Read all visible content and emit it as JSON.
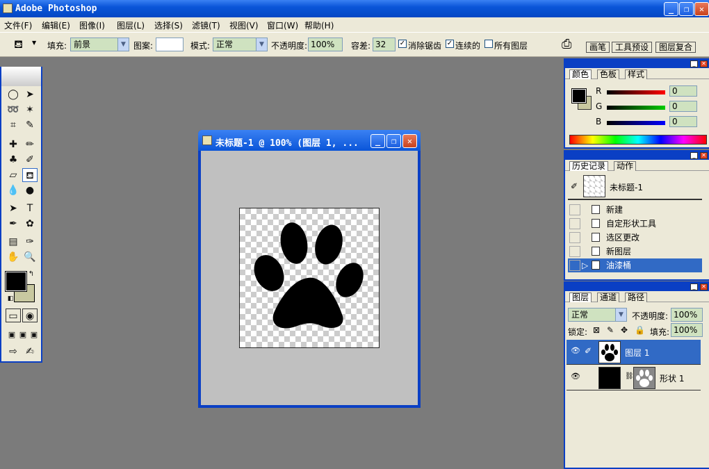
{
  "app": {
    "title": "Adobe Photoshop",
    "window_buttons": {
      "minimize": "_",
      "restore": "❐",
      "close": "✕"
    }
  },
  "menu": [
    "文件(F)",
    "编辑(E)",
    "图像(I)",
    "图层(L)",
    "选择(S)",
    "滤镜(T)",
    "视图(V)",
    "窗口(W)",
    "帮助(H)"
  ],
  "options": {
    "fill_label": "填充:",
    "fill_value": "前景",
    "pattern_label": "图案:",
    "mode_label": "模式:",
    "mode_value": "正常",
    "opacity_label": "不透明度:",
    "opacity_value": "100%",
    "tolerance_label": "容差:",
    "tolerance_value": "32",
    "antialias_label": "消除锯齿",
    "antialias_checked": true,
    "contiguous_label": "连续的",
    "contiguous_checked": true,
    "all_layers_label": "所有图层",
    "all_layers_checked": false,
    "well_tabs": [
      "画笔",
      "工具预设",
      "图层复合"
    ]
  },
  "document": {
    "title": "未标题-1 @ 100% (图层 1, ..."
  },
  "color_panel": {
    "tabs": [
      "颜色",
      "色板",
      "样式"
    ],
    "channels": [
      {
        "name": "R",
        "value": "0"
      },
      {
        "name": "G",
        "value": "0"
      },
      {
        "name": "B",
        "value": "0"
      }
    ],
    "foreground": "#000000",
    "background": "#c8c8a0"
  },
  "history_panel": {
    "tabs": [
      "历史记录",
      "动作"
    ],
    "snapshot": "未标题-1",
    "items": [
      "新建",
      "自定形状工具",
      "选区更改",
      "新图层",
      "油漆桶"
    ],
    "active_index": 4
  },
  "layers_panel": {
    "tabs": [
      "图层",
      "通道",
      "路径"
    ],
    "blend_mode": "正常",
    "opacity_label": "不透明度:",
    "opacity_value": "100%",
    "lock_label": "锁定:",
    "fill_label": "填充:",
    "fill_value": "100%",
    "layers": [
      {
        "name": "图层 1",
        "active": true
      },
      {
        "name": "形状 1",
        "active": false
      }
    ]
  },
  "colors": {
    "title_blue": "#0a55d8",
    "panel_bg": "#ece9d8",
    "selection": "#316ac5",
    "workspace": "#7b7b7b"
  }
}
